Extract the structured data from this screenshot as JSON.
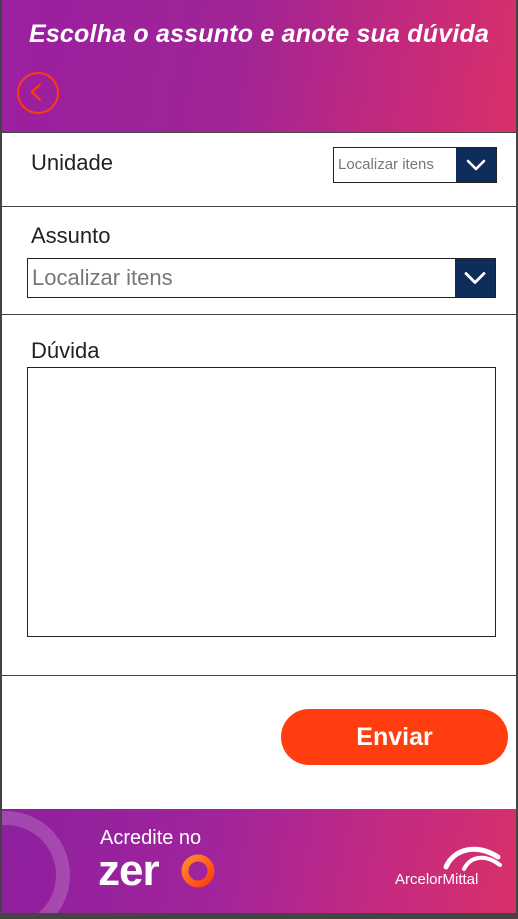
{
  "header": {
    "title": "Escolha o assunto e anote sua dúvida",
    "back_icon": "chevron-left-circle-icon"
  },
  "form": {
    "unidade": {
      "label": "Unidade",
      "placeholder": "Localizar itens"
    },
    "assunto": {
      "label": "Assunto",
      "placeholder": "Localizar itens"
    },
    "duvida": {
      "label": "Dúvida",
      "value": ""
    },
    "submit_label": "Enviar"
  },
  "footer": {
    "slogan_line1": "Acredite no",
    "slogan_line2": "zer",
    "brand": "ArcelorMittal"
  },
  "colors": {
    "header_gradient_start": "#9b1fa0",
    "header_gradient_end": "#d8306a",
    "accent_orange": "#ff3d0e",
    "dropdown_navy": "#0f2d5a"
  }
}
